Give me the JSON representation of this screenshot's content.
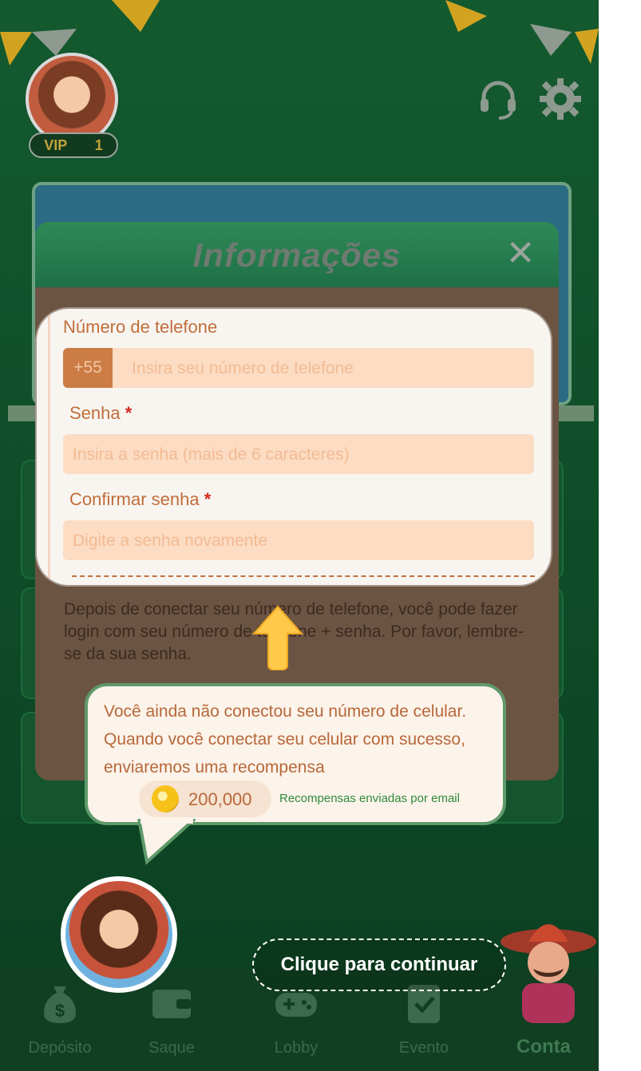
{
  "header": {
    "vip_label": "VIP",
    "vip_level": "1",
    "icons": [
      "headset-icon",
      "gear-icon"
    ]
  },
  "modal": {
    "title": "Informações",
    "close_icon": "close-icon",
    "info_text": "Depois de conectar seu número de telefone, você pode fazer login com seu número de telefone + senha. Por favor, lembre-se da sua senha."
  },
  "form": {
    "phone": {
      "label": "Número de telefone",
      "prefix": "+55",
      "placeholder": "Insira seu número de telefone"
    },
    "password": {
      "label": "Senha",
      "required_mark": "*",
      "placeholder": "Insira a senha (mais de 6 caracteres)"
    },
    "confirm_password": {
      "label": "Confirmar senha",
      "required_mark": "*",
      "placeholder": "Digite a senha novamente"
    }
  },
  "tip": {
    "text": "Você ainda não conectou seu número de celular. Quando você conectar seu celular com sucesso, enviaremos uma recompensa",
    "coin_amount": "200,000",
    "reward_note": "Recompensas enviadas por email"
  },
  "continue_label": "Clique para continuar",
  "nav": [
    {
      "label": "Depósito",
      "icon": "money-bag-icon"
    },
    {
      "label": "Saque",
      "icon": "wallet-icon"
    },
    {
      "label": "Lobby",
      "icon": "gamepad-icon"
    },
    {
      "label": "Evento",
      "icon": "checklist-icon"
    },
    {
      "label": "Conta",
      "icon": "character-icon",
      "active": true
    }
  ],
  "colors": {
    "background": "#0f4f29",
    "label": "#c06e3a",
    "input_bg": "#fcdcc3",
    "placeholder": "#f3bb93",
    "required": "#d32a21",
    "bubble_border": "#5f9a6a",
    "reward_note": "#2f8a3a"
  }
}
